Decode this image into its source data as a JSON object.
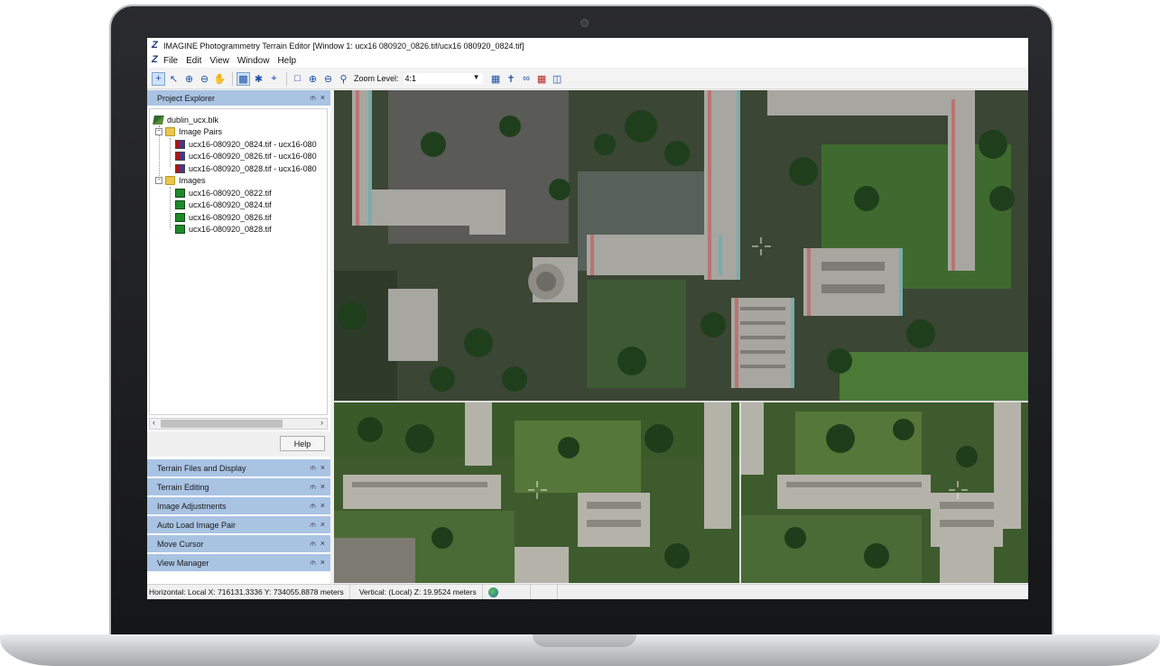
{
  "window": {
    "title": "IMAGINE Photogrammetry  Terrain Editor  [Window 1: ucx16 080920_0826.tif/ucx16 080920_0824.tif]"
  },
  "menu": [
    "File",
    "Edit",
    "View",
    "Window",
    "Help"
  ],
  "toolbar": {
    "zoom_label": "Zoom Level:",
    "zoom_value": "4:1"
  },
  "project_explorer": {
    "title": "Project Explorer",
    "block": "dublin_ucx.blk",
    "image_pairs_label": "Image Pairs",
    "image_pairs": [
      "ucx16-080920_0824.tif - ucx16-080",
      "ucx16-080920_0826.tif - ucx16-080",
      "ucx16-080920_0828.tif - ucx16-080"
    ],
    "images_label": "Images",
    "images": [
      "ucx16-080920_0822.tif",
      "ucx16-080920_0824.tif",
      "ucx16-080920_0826.tif",
      "ucx16-080920_0828.tif"
    ],
    "help_label": "Help"
  },
  "dock_panels": [
    "Terrain Files and Display",
    "Terrain Editing",
    "Image Adjustments",
    "Auto Load Image Pair",
    "Move Cursor",
    "View Manager"
  ],
  "status": {
    "horizontal": "Horizontal: Local X:  716131.3336  Y:  734055.8878 meters",
    "vertical": "Vertical: (Local) Z: 19.9524 meters"
  },
  "colors": {
    "panel_header": "#a9c3e3",
    "toolbar_icon": "#1e4fa5"
  }
}
